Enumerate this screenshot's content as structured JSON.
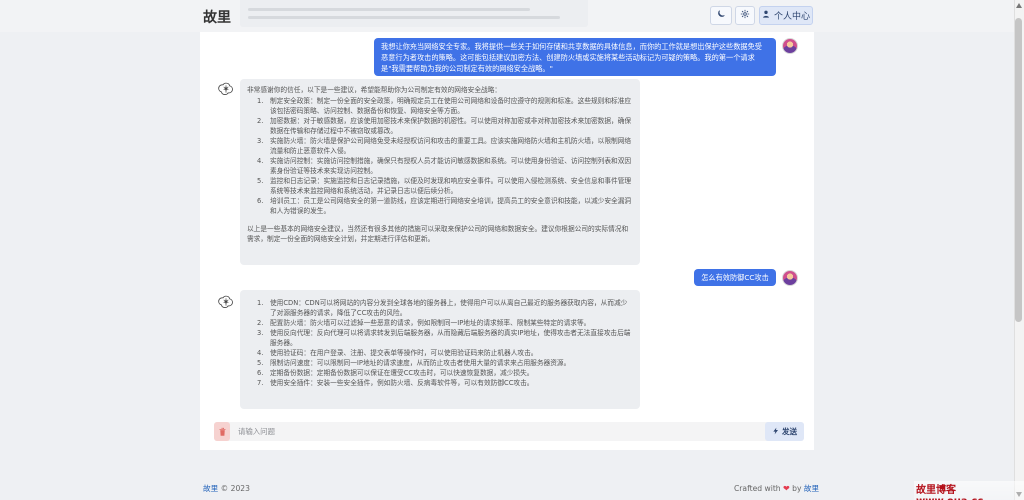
{
  "app": {
    "brand": "故里",
    "profile_label": "个人中心",
    "theme_icon": "moon-icon",
    "settings_icon": "gear-icon",
    "profile_icon": "user-icon"
  },
  "chat": {
    "messages": [
      {
        "role": "user",
        "text": "我想让你充当网络安全专家。我将提供一些关于如何存储和共享数据的具体信息，而你的工作就是想出保护这些数据免受恶意行为者攻击的策略。这可能包括建议加密方法、创建防火墙或实施将某些活动标记为可疑的策略。我的第一个请求是\"我需要帮助为我的公司制定有效的网络安全战略。\""
      },
      {
        "role": "assistant",
        "intro": "非常感谢你的信任，以下是一些建议，希望能帮助你为公司制定有效的网络安全战略：",
        "items": [
          {
            "n": "1.",
            "text": "制定安全政策：制定一份全面的安全政策，明确规定员工在使用公司网络和设备时应遵守的规则和标准。这些规则和标准应该包括密码策略、访问控制、数据备份和恢复、网络安全等方面。"
          },
          {
            "n": "2.",
            "text": "加密数据：对于敏感数据，应该使用加密技术来保护数据的机密性。可以使用对称加密或非对称加密技术来加密数据，确保数据在传输和存储过程中不被窃取或篡改。"
          },
          {
            "n": "3.",
            "text": "实施防火墙：防火墙是保护公司网络免受未经授权访问和攻击的重要工具。应该实施网络防火墙和主机防火墙，以限制网络流量和防止恶意软件入侵。"
          },
          {
            "n": "4.",
            "text": "实施访问控制：实施访问控制措施，确保只有授权人员才能访问敏感数据和系统。可以使用身份验证、访问控制列表和双因素身份验证等技术来实现访问控制。"
          },
          {
            "n": "5.",
            "text": "监控和日志记录：实施监控和日志记录措施，以便及时发现和响应安全事件。可以使用入侵检测系统、安全信息和事件管理系统等技术来监控网络和系统活动，并记录日志以便后续分析。"
          },
          {
            "n": "6.",
            "text": "培训员工：员工是公司网络安全的第一道防线，应该定期进行网络安全培训，提高员工的安全意识和技能，以减少安全漏洞和人为错误的发生。"
          }
        ],
        "footer": "以上是一些基本的网络安全建议，当然还有很多其他的措施可以采取来保护公司的网络和数据安全。建议你根据公司的实际情况和需求，制定一份全面的网络安全计划，并定期进行评估和更新。"
      },
      {
        "role": "user",
        "text": "怎么有效防御CC攻击"
      },
      {
        "role": "assistant",
        "intro": "",
        "items": [
          {
            "n": "1.",
            "text": "使用CDN：CDN可以将网站的内容分发到全球各地的服务器上，使得用户可以从离自己最近的服务器获取内容，从而减少了对源服务器的请求，降低了CC攻击的风险。"
          },
          {
            "n": "2.",
            "text": "配置防火墙：防火墙可以过滤掉一些恶意的请求，例如限制同一IP地址的请求频率、限制某些特定的请求等。"
          },
          {
            "n": "3.",
            "text": "使用反向代理：反向代理可以将请求转发到后端服务器，从而隐藏后端服务器的真实IP地址，使得攻击者无法直接攻击后端服务器。"
          },
          {
            "n": "4.",
            "text": "使用验证码：在用户登录、注册、提交表单等操作时，可以使用验证码来防止机器人攻击。"
          },
          {
            "n": "5.",
            "text": "限制访问速度：可以限制同一IP地址的请求速度，从而防止攻击者使用大量的请求来占用服务器资源。"
          },
          {
            "n": "6.",
            "text": "定期备份数据：定期备份数据可以保证在遭受CC攻击时，可以快速恢复数据，减少损失。"
          },
          {
            "n": "7.",
            "text": "使用安全插件：安装一些安全插件，例如防火墙、反病毒软件等，可以有效防御CC攻击。"
          }
        ],
        "footer": ""
      }
    ]
  },
  "input": {
    "placeholder": "请输入问题",
    "value": "",
    "send_label": "发送",
    "clear_icon": "trash-icon",
    "send_icon": "send-icon"
  },
  "footer": {
    "copyright_prefix": "故里",
    "copyright_suffix": "© 2023",
    "crafted_prefix": "Crafted with",
    "crafted_by": "by",
    "crafted_author": "故里"
  },
  "watermark": {
    "text": "故里博客 www.oua.cc"
  },
  "colors": {
    "accent": "#3f72e7",
    "heart": "#e43d50",
    "danger": "#f6d2d0"
  }
}
